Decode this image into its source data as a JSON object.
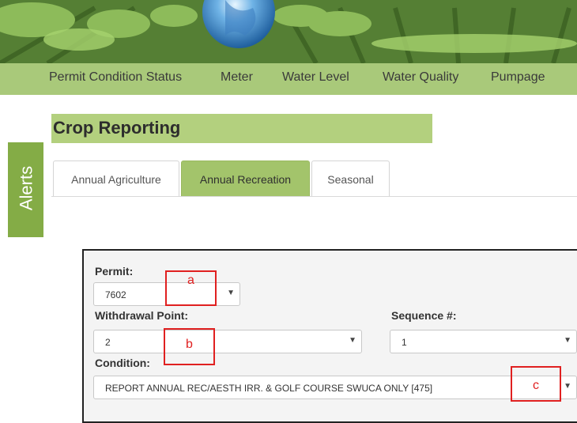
{
  "header": {
    "banner_image": "tea-field-with-globe"
  },
  "nav": {
    "items": [
      "Permit Condition Status",
      "Meter",
      "Water Level",
      "Water Quality",
      "Pumpage"
    ]
  },
  "alerts": {
    "label": "Alerts"
  },
  "page": {
    "title": "Crop Reporting"
  },
  "tabs": [
    {
      "label": "Annual Agriculture",
      "active": false
    },
    {
      "label": "Annual Recreation",
      "active": true
    },
    {
      "label": "Seasonal",
      "active": false
    }
  ],
  "form": {
    "permit": {
      "label": "Permit:",
      "value": "7602"
    },
    "withdrawal": {
      "label": "Withdrawal Point:",
      "value": "2"
    },
    "sequence": {
      "label": "Sequence #:",
      "value": "1"
    },
    "condition": {
      "label": "Condition:",
      "value": "REPORT ANNUAL REC/AESTH IRR. & GOLF COURSE SWUCA ONLY [475]"
    }
  },
  "annotations": {
    "a": "a",
    "b": "b",
    "c": "c"
  },
  "colors": {
    "nav_bg": "#a9c97a",
    "accent": "#84ac46",
    "title_bg": "#b3d07e",
    "active_tab": "#a3c46b",
    "annotation": "#e02020"
  }
}
